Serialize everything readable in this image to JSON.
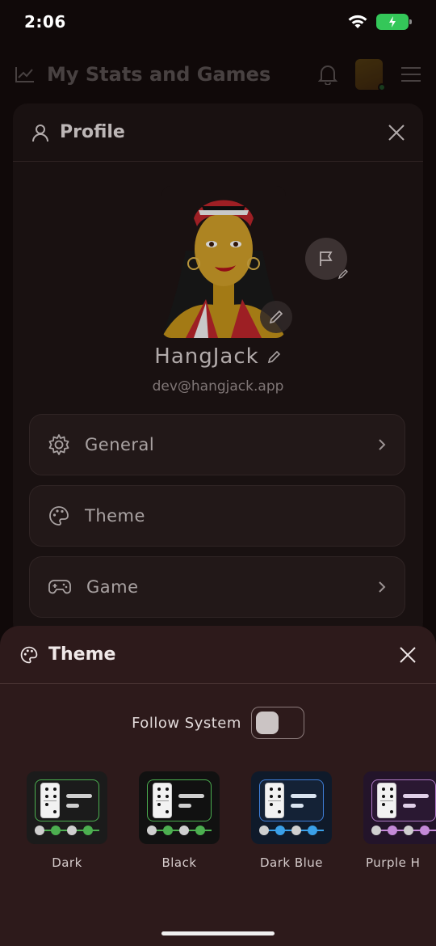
{
  "status_bar": {
    "time": "2:06"
  },
  "app_header": {
    "title": "My Stats and Games"
  },
  "profile": {
    "title": "Profile",
    "username": "HangJack",
    "email": "dev@hangjack.app",
    "menu": [
      {
        "label": "General",
        "icon": "gear-icon"
      },
      {
        "label": "Theme",
        "icon": "palette-icon"
      },
      {
        "label": "Game",
        "icon": "gamepad-icon"
      }
    ]
  },
  "theme_sheet": {
    "title": "Theme",
    "follow_system_label": "Follow System",
    "follow_system_on": false,
    "themes": [
      {
        "name": "Dark",
        "bg": "#1b1b1b",
        "inner": "#1b1b1b",
        "border": "#4caf50",
        "accent": "#4caf50",
        "bar": "#cfcfcf"
      },
      {
        "name": "Black",
        "bg": "#111111",
        "inner": "#111111",
        "border": "#4caf50",
        "accent": "#4caf50",
        "bar": "#cfcfcf"
      },
      {
        "name": "Dark Blue",
        "bg": "#0f1a2a",
        "inner": "#142236",
        "border": "#3f7fd9",
        "accent": "#3aa0e8",
        "bar": "#d9e4f0"
      },
      {
        "name": "Purple H",
        "bg": "#23142a",
        "inner": "#2a1832",
        "border": "#b07ac7",
        "accent": "#c48ad8",
        "bar": "#e0d0e8"
      }
    ]
  },
  "colors": {
    "sheet_bg": "#2d1a1b",
    "panel_bg": "#1f1515",
    "accent_green": "#34c759"
  }
}
